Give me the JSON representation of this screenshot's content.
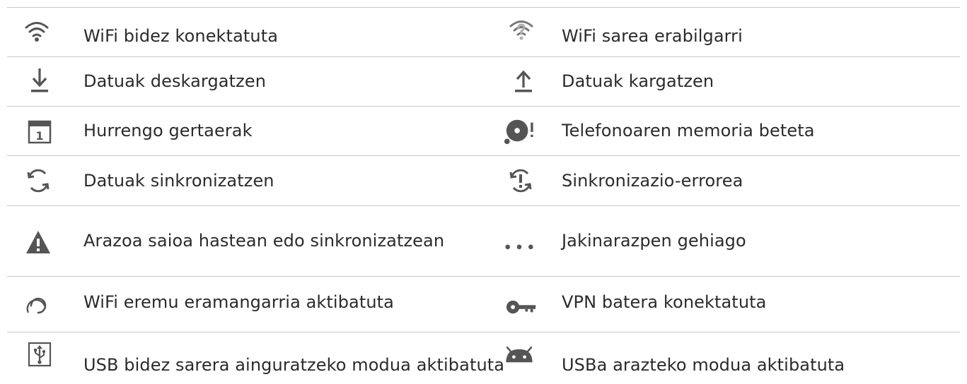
{
  "colors": {
    "text": "#2b2b2b",
    "icon": "#555555",
    "rule": "#c8c8c8",
    "background": "#ffffff"
  },
  "rows": [
    {
      "left": {
        "icon": "wifi-connected-icon",
        "label": "WiFi bidez konektatuta"
      },
      "right": {
        "icon": "wifi-available-icon",
        "label": "WiFi sarea erabilgarri"
      }
    },
    {
      "left": {
        "icon": "download-icon",
        "label": "Datuak deskargatzen"
      },
      "right": {
        "icon": "upload-icon",
        "label": "Datuak kargatzen"
      }
    },
    {
      "left": {
        "icon": "calendar-icon",
        "label": "Hurrengo gertaerak",
        "icon_text": "1"
      },
      "right": {
        "icon": "storage-full-icon",
        "label": "Telefonoaren memoria beteta"
      }
    },
    {
      "left": {
        "icon": "sync-icon",
        "label": "Datuak sinkronizatzen"
      },
      "right": {
        "icon": "sync-error-icon",
        "label": "Sinkronizazio-errorea"
      }
    },
    {
      "left": {
        "icon": "warning-icon",
        "label": "Arazoa saioa hastean edo sinkronizatzean"
      },
      "right": {
        "icon": "more-notifications-icon",
        "label": "Jakinarazpen gehiago"
      }
    },
    {
      "left": {
        "icon": "hotspot-icon",
        "label": "WiFi eremu eramangarria aktibatuta"
      },
      "right": {
        "icon": "vpn-key-icon",
        "label": "VPN batera konektatuta"
      }
    },
    {
      "left": {
        "icon": "usb-tethering-icon",
        "label": "USB bidez sarera ainguratzeko modua aktibatuta"
      },
      "right": {
        "icon": "android-debug-icon",
        "label": "USBa arazteko modua aktibatuta"
      }
    }
  ]
}
